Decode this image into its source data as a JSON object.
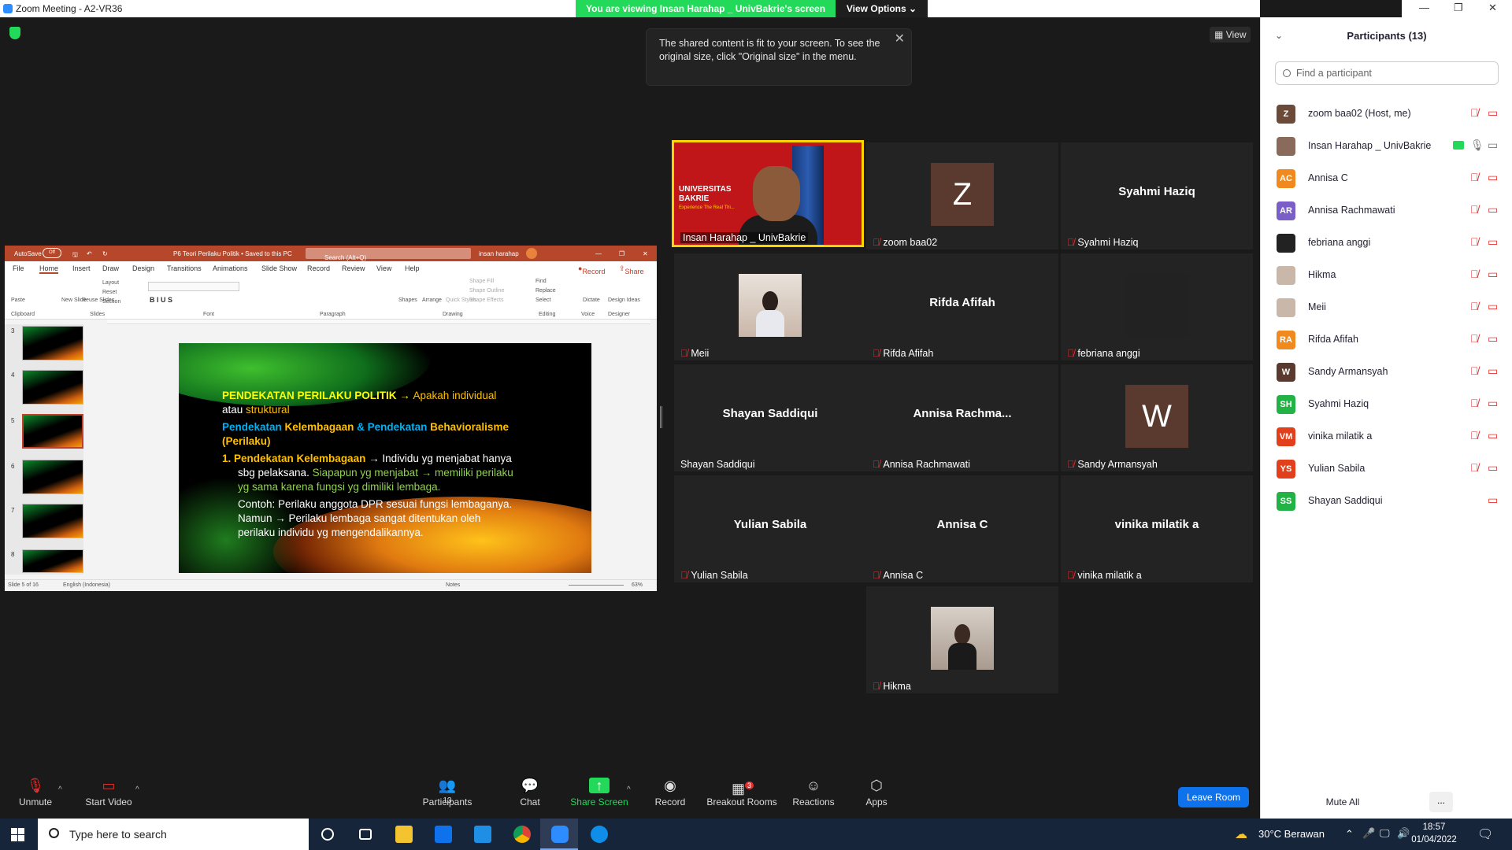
{
  "window": {
    "title": "Zoom Meeting - A2-VR36"
  },
  "share_banner": {
    "message": "You are viewing Insan Harahap _ UnivBakrie's screen",
    "view_options": "View Options"
  },
  "view_button": "View",
  "tooltip": {
    "text": "The shared content is fit to your screen. To see the original size, click \"Original size\" in the menu."
  },
  "powerpoint": {
    "autosave": "AutoSave",
    "autosave_state": "Off",
    "doc_title": "P6 Teori Perilaku Politik • Saved to this PC",
    "search_placeholder": "Search (Alt+Q)",
    "user": "insan harahap",
    "tabs": [
      "File",
      "Home",
      "Insert",
      "Draw",
      "Design",
      "Transitions",
      "Animations",
      "Slide Show",
      "Record",
      "Review",
      "View",
      "Help"
    ],
    "record_btn": "Record",
    "share_btn": "Share",
    "ribbon_groups": [
      "Clipboard",
      "Slides",
      "Font",
      "Paragraph",
      "Drawing",
      "Editing",
      "Voice",
      "Designer"
    ],
    "ribbon_items": {
      "paste": "Paste",
      "new_slide": "New Slide",
      "reuse": "Reuse Slides",
      "layout": "Layout",
      "reset": "Reset",
      "section": "Section",
      "shapes": "Shapes",
      "arrange": "Arrange",
      "quick_styles": "Quick Styles",
      "shape_fill": "Shape Fill",
      "shape_outline": "Shape Outline",
      "shape_effects": "Shape Effects",
      "find": "Find",
      "replace": "Replace",
      "select": "Select",
      "dictate": "Dictate",
      "design_ideas": "Design Ideas"
    },
    "thumb_numbers": [
      "3",
      "4",
      "5",
      "6",
      "7",
      "8"
    ],
    "status_left": "Slide 5 of 16",
    "status_lang": "English (Indonesia)",
    "status_notes": "Notes",
    "zoom": "63%",
    "slide": {
      "l1a": "PENDEKATAN PERILAKU POLITIK →",
      "l1b": "Apakah individual",
      "l2a": "atau",
      "l2b": "struktural",
      "l3a": "Pendekatan",
      "l3b": "Kelembagaan",
      "l3c": "& Pendekatan",
      "l3d": "Behavioralisme",
      "l4": "(Perilaku)",
      "l5a": "1. Pendekatan Kelembagaan",
      "l5b": "→ Individu yg menjabat hanya",
      "l6a": "sbg pelaksana.",
      "l6b": "Siapapun yg menjabat → memiliki perilaku",
      "l7": "yg sama karena fungsi yg dimiliki lembaga.",
      "l8": "Contoh: Perilaku anggota DPR sesuai fungsi lembaganya.",
      "l9": "Namun → Perilaku lembaga sangat ditentukan oleh",
      "l10": "perilaku individu yg mengendalikannya."
    }
  },
  "video_tiles": [
    {
      "name": "Insan Harahap _ UnivBakrie",
      "muted": false,
      "banner": "UNIVERSITAS BAKRIE",
      "tagline": "Experience The Real Thi..."
    },
    {
      "name": "zoom baa02",
      "avatar": "Z",
      "muted": true
    },
    {
      "name": "Syahmi Haziq",
      "display": "Syahmi Haziq",
      "muted": true
    },
    {
      "name": "Meii",
      "muted": true
    },
    {
      "name": "Rifda Afifah",
      "display": "Rifda Afifah",
      "muted": true
    },
    {
      "name": "febriana anggi",
      "muted": true
    },
    {
      "name": "Shayan Saddiqui",
      "display": "Shayan Saddiqui",
      "muted": false
    },
    {
      "name": "Annisa Rachmawati",
      "display": "Annisa  Rachma...",
      "muted": true
    },
    {
      "name": "Sandy Armansyah",
      "avatar": "W",
      "muted": true
    },
    {
      "name": "Yulian Sabila",
      "display": "Yulian Sabila",
      "muted": true
    },
    {
      "name": "Annisa C",
      "display": "Annisa C",
      "muted": true
    },
    {
      "name": "vinika milatik a",
      "display": "vinika milatik a",
      "muted": true
    },
    {
      "name": "Hikma",
      "muted": true
    }
  ],
  "participants": {
    "title": "Participants (13)",
    "search_placeholder": "Find a participant",
    "list": [
      {
        "initials": "Z",
        "name": "zoom baa02 (Host, me)",
        "color": "#6b4a3a"
      },
      {
        "initials": "",
        "name": "Insan Harahap _ UnivBakrie",
        "color": "#8a6a5a"
      },
      {
        "initials": "AC",
        "name": "Annisa C",
        "color": "#f08a1e"
      },
      {
        "initials": "AR",
        "name": "Annisa Rachmawati",
        "color": "#7b5fc9"
      },
      {
        "initials": "",
        "name": "febriana anggi",
        "color": "#222222"
      },
      {
        "initials": "",
        "name": "Hikma",
        "color": "#c9b7a9"
      },
      {
        "initials": "",
        "name": "Meii",
        "color": "#c9b7a9"
      },
      {
        "initials": "RA",
        "name": "Rifda Afifah",
        "color": "#f08a1e"
      },
      {
        "initials": "W",
        "name": "Sandy Armansyah",
        "color": "#5a3a2e"
      },
      {
        "initials": "SH",
        "name": "Syahmi Haziq",
        "color": "#23b245"
      },
      {
        "initials": "VM",
        "name": "vinika milatik a",
        "color": "#e2401c"
      },
      {
        "initials": "YS",
        "name": "Yulian Sabila",
        "color": "#e2401c"
      },
      {
        "initials": "SS",
        "name": "Shayan Saddiqui",
        "color": "#23b245"
      }
    ],
    "mute_all": "Mute All",
    "more": "..."
  },
  "toolbar": {
    "unmute": "Unmute",
    "start_video": "Start Video",
    "participants": "Participants",
    "participants_count": "13",
    "chat": "Chat",
    "share_screen": "Share Screen",
    "record": "Record",
    "breakout": "Breakout Rooms",
    "breakout_badge": "3",
    "reactions": "Reactions",
    "apps": "Apps",
    "leave": "Leave Room"
  },
  "taskbar": {
    "search_placeholder": "Type here to search",
    "weather": "30°C  Berawan",
    "time": "18:57",
    "date": "01/04/2022"
  }
}
